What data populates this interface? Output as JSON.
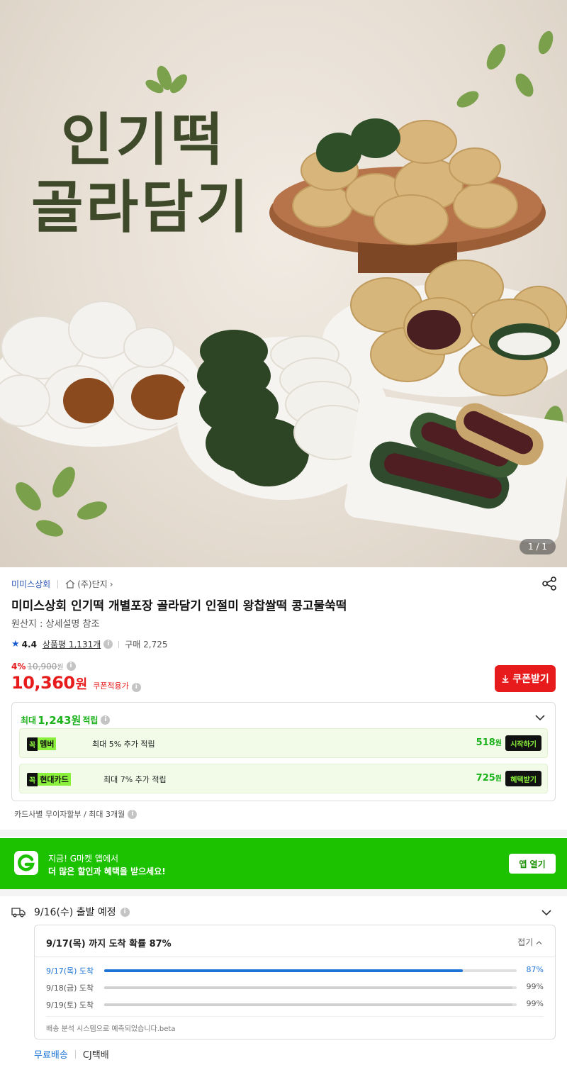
{
  "hero": {
    "title_line1": "인기떡",
    "title_line2": "골라담기",
    "counter": "1 / 1"
  },
  "product": {
    "seller": "미미스상회",
    "brand": "(주)단지",
    "brand_chevron": "›",
    "title": "미미스상회 인기떡 개별포장 골라담기 인절미 왕찹쌀떡 콩고물쑥떡",
    "origin": "원산지 : 상세설명 참조",
    "rating": "4.4",
    "review_label": "상품평 1,131개",
    "purchase_count": "구매 2,725",
    "discount_rate": "4%",
    "original_price": "10,900",
    "original_won": "원",
    "price": "10,360",
    "won": "원",
    "coupon_price_label": "쿠폰적용가",
    "coupon_button": "쿠폰받기"
  },
  "points": {
    "prefix": "최대",
    "amount": "1,243원",
    "suffix": "적립",
    "cards": [
      {
        "g": "꼭",
        "name": "멤버",
        "desc": "최대 5% 추가 적립",
        "amount": "518",
        "won": "원",
        "button": "시작하기"
      },
      {
        "g": "꼭",
        "name": "현대카드",
        "desc": "최대 7% 추가 적립",
        "amount": "725",
        "won": "원",
        "button": "혜택받기"
      }
    ]
  },
  "installment": "카드사별 무이자할부 / 최대 3개월",
  "app_banner": {
    "line1": "지금! G마켓 앱에서",
    "line2": "더 많은 할인과 혜택을 받으세요!",
    "button": "앱 열기"
  },
  "shipping": {
    "dispatch": "9/16(수) 출발 예정",
    "prob_title": "9/17(목) 까지 도착 확률 87%",
    "fold_label": "접기",
    "rows": [
      {
        "label": "9/17(목) 도착",
        "value": "87%",
        "fraction": 0.87,
        "active": true
      },
      {
        "label": "9/18(금) 도착",
        "value": "99%",
        "fraction": 0.99,
        "active": false
      },
      {
        "label": "9/19(토) 도착",
        "value": "99%",
        "fraction": 0.99,
        "active": false
      }
    ],
    "note": "배송 분석 시스템으로 예측되었습니다.beta",
    "free_shipping": "무료배송",
    "courier": "CJ택배"
  },
  "colors": {
    "accent_red": "#e71b1b",
    "gmarket_green": "#1cc200",
    "link_blue": "#1e74d6",
    "point_green": "#1bb21b"
  },
  "icons": [
    "share-icon",
    "home-icon",
    "star-icon",
    "info-icon",
    "download-icon",
    "chevron-down-icon",
    "gmarket-logo-icon",
    "truck-icon",
    "chevron-up-icon"
  ]
}
